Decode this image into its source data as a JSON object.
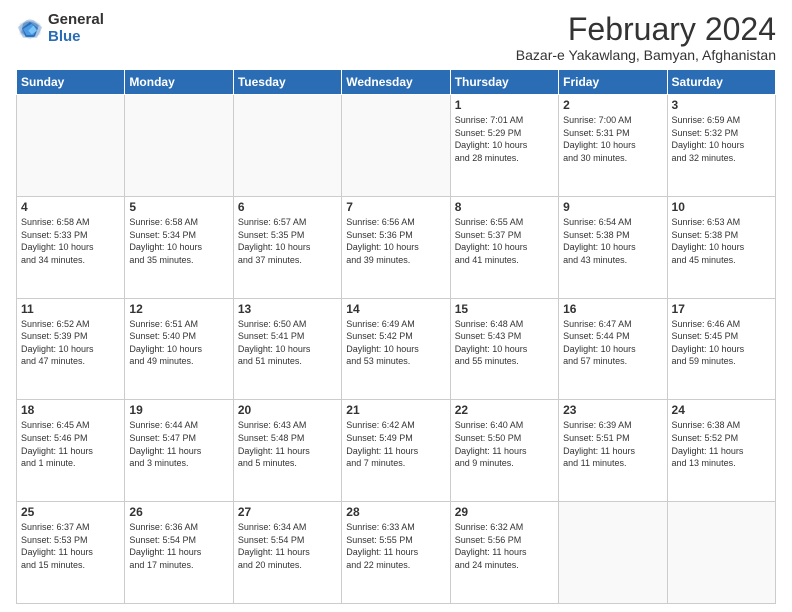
{
  "logo": {
    "general": "General",
    "blue": "Blue"
  },
  "title": "February 2024",
  "subtitle": "Bazar-e Yakawlang, Bamyan, Afghanistan",
  "days_header": [
    "Sunday",
    "Monday",
    "Tuesday",
    "Wednesday",
    "Thursday",
    "Friday",
    "Saturday"
  ],
  "weeks": [
    [
      {
        "day": "",
        "info": ""
      },
      {
        "day": "",
        "info": ""
      },
      {
        "day": "",
        "info": ""
      },
      {
        "day": "",
        "info": ""
      },
      {
        "day": "1",
        "info": "Sunrise: 7:01 AM\nSunset: 5:29 PM\nDaylight: 10 hours\nand 28 minutes."
      },
      {
        "day": "2",
        "info": "Sunrise: 7:00 AM\nSunset: 5:31 PM\nDaylight: 10 hours\nand 30 minutes."
      },
      {
        "day": "3",
        "info": "Sunrise: 6:59 AM\nSunset: 5:32 PM\nDaylight: 10 hours\nand 32 minutes."
      }
    ],
    [
      {
        "day": "4",
        "info": "Sunrise: 6:58 AM\nSunset: 5:33 PM\nDaylight: 10 hours\nand 34 minutes."
      },
      {
        "day": "5",
        "info": "Sunrise: 6:58 AM\nSunset: 5:34 PM\nDaylight: 10 hours\nand 35 minutes."
      },
      {
        "day": "6",
        "info": "Sunrise: 6:57 AM\nSunset: 5:35 PM\nDaylight: 10 hours\nand 37 minutes."
      },
      {
        "day": "7",
        "info": "Sunrise: 6:56 AM\nSunset: 5:36 PM\nDaylight: 10 hours\nand 39 minutes."
      },
      {
        "day": "8",
        "info": "Sunrise: 6:55 AM\nSunset: 5:37 PM\nDaylight: 10 hours\nand 41 minutes."
      },
      {
        "day": "9",
        "info": "Sunrise: 6:54 AM\nSunset: 5:38 PM\nDaylight: 10 hours\nand 43 minutes."
      },
      {
        "day": "10",
        "info": "Sunrise: 6:53 AM\nSunset: 5:38 PM\nDaylight: 10 hours\nand 45 minutes."
      }
    ],
    [
      {
        "day": "11",
        "info": "Sunrise: 6:52 AM\nSunset: 5:39 PM\nDaylight: 10 hours\nand 47 minutes."
      },
      {
        "day": "12",
        "info": "Sunrise: 6:51 AM\nSunset: 5:40 PM\nDaylight: 10 hours\nand 49 minutes."
      },
      {
        "day": "13",
        "info": "Sunrise: 6:50 AM\nSunset: 5:41 PM\nDaylight: 10 hours\nand 51 minutes."
      },
      {
        "day": "14",
        "info": "Sunrise: 6:49 AM\nSunset: 5:42 PM\nDaylight: 10 hours\nand 53 minutes."
      },
      {
        "day": "15",
        "info": "Sunrise: 6:48 AM\nSunset: 5:43 PM\nDaylight: 10 hours\nand 55 minutes."
      },
      {
        "day": "16",
        "info": "Sunrise: 6:47 AM\nSunset: 5:44 PM\nDaylight: 10 hours\nand 57 minutes."
      },
      {
        "day": "17",
        "info": "Sunrise: 6:46 AM\nSunset: 5:45 PM\nDaylight: 10 hours\nand 59 minutes."
      }
    ],
    [
      {
        "day": "18",
        "info": "Sunrise: 6:45 AM\nSunset: 5:46 PM\nDaylight: 11 hours\nand 1 minute."
      },
      {
        "day": "19",
        "info": "Sunrise: 6:44 AM\nSunset: 5:47 PM\nDaylight: 11 hours\nand 3 minutes."
      },
      {
        "day": "20",
        "info": "Sunrise: 6:43 AM\nSunset: 5:48 PM\nDaylight: 11 hours\nand 5 minutes."
      },
      {
        "day": "21",
        "info": "Sunrise: 6:42 AM\nSunset: 5:49 PM\nDaylight: 11 hours\nand 7 minutes."
      },
      {
        "day": "22",
        "info": "Sunrise: 6:40 AM\nSunset: 5:50 PM\nDaylight: 11 hours\nand 9 minutes."
      },
      {
        "day": "23",
        "info": "Sunrise: 6:39 AM\nSunset: 5:51 PM\nDaylight: 11 hours\nand 11 minutes."
      },
      {
        "day": "24",
        "info": "Sunrise: 6:38 AM\nSunset: 5:52 PM\nDaylight: 11 hours\nand 13 minutes."
      }
    ],
    [
      {
        "day": "25",
        "info": "Sunrise: 6:37 AM\nSunset: 5:53 PM\nDaylight: 11 hours\nand 15 minutes."
      },
      {
        "day": "26",
        "info": "Sunrise: 6:36 AM\nSunset: 5:54 PM\nDaylight: 11 hours\nand 17 minutes."
      },
      {
        "day": "27",
        "info": "Sunrise: 6:34 AM\nSunset: 5:54 PM\nDaylight: 11 hours\nand 20 minutes."
      },
      {
        "day": "28",
        "info": "Sunrise: 6:33 AM\nSunset: 5:55 PM\nDaylight: 11 hours\nand 22 minutes."
      },
      {
        "day": "29",
        "info": "Sunrise: 6:32 AM\nSunset: 5:56 PM\nDaylight: 11 hours\nand 24 minutes."
      },
      {
        "day": "",
        "info": ""
      },
      {
        "day": "",
        "info": ""
      }
    ]
  ]
}
